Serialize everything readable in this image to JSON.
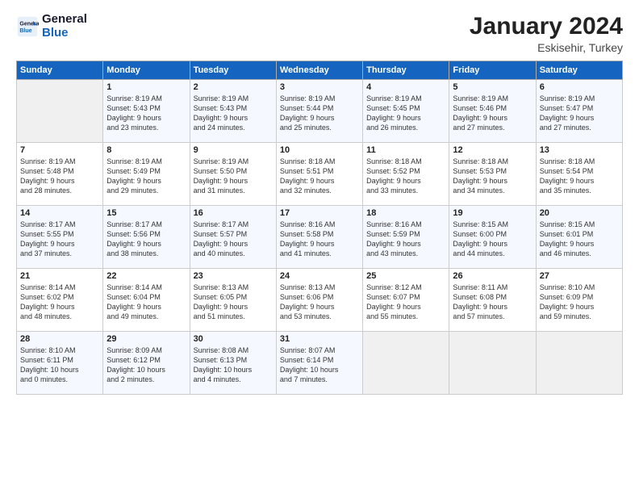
{
  "logo": {
    "line1": "General",
    "line2": "Blue"
  },
  "title": "January 2024",
  "subtitle": "Eskisehir, Turkey",
  "weekdays": [
    "Sunday",
    "Monday",
    "Tuesday",
    "Wednesday",
    "Thursday",
    "Friday",
    "Saturday"
  ],
  "weeks": [
    [
      {
        "day": "",
        "info": ""
      },
      {
        "day": "1",
        "info": "Sunrise: 8:19 AM\nSunset: 5:43 PM\nDaylight: 9 hours\nand 23 minutes."
      },
      {
        "day": "2",
        "info": "Sunrise: 8:19 AM\nSunset: 5:43 PM\nDaylight: 9 hours\nand 24 minutes."
      },
      {
        "day": "3",
        "info": "Sunrise: 8:19 AM\nSunset: 5:44 PM\nDaylight: 9 hours\nand 25 minutes."
      },
      {
        "day": "4",
        "info": "Sunrise: 8:19 AM\nSunset: 5:45 PM\nDaylight: 9 hours\nand 26 minutes."
      },
      {
        "day": "5",
        "info": "Sunrise: 8:19 AM\nSunset: 5:46 PM\nDaylight: 9 hours\nand 27 minutes."
      },
      {
        "day": "6",
        "info": "Sunrise: 8:19 AM\nSunset: 5:47 PM\nDaylight: 9 hours\nand 27 minutes."
      }
    ],
    [
      {
        "day": "7",
        "info": "Sunrise: 8:19 AM\nSunset: 5:48 PM\nDaylight: 9 hours\nand 28 minutes."
      },
      {
        "day": "8",
        "info": "Sunrise: 8:19 AM\nSunset: 5:49 PM\nDaylight: 9 hours\nand 29 minutes."
      },
      {
        "day": "9",
        "info": "Sunrise: 8:19 AM\nSunset: 5:50 PM\nDaylight: 9 hours\nand 31 minutes."
      },
      {
        "day": "10",
        "info": "Sunrise: 8:18 AM\nSunset: 5:51 PM\nDaylight: 9 hours\nand 32 minutes."
      },
      {
        "day": "11",
        "info": "Sunrise: 8:18 AM\nSunset: 5:52 PM\nDaylight: 9 hours\nand 33 minutes."
      },
      {
        "day": "12",
        "info": "Sunrise: 8:18 AM\nSunset: 5:53 PM\nDaylight: 9 hours\nand 34 minutes."
      },
      {
        "day": "13",
        "info": "Sunrise: 8:18 AM\nSunset: 5:54 PM\nDaylight: 9 hours\nand 35 minutes."
      }
    ],
    [
      {
        "day": "14",
        "info": "Sunrise: 8:17 AM\nSunset: 5:55 PM\nDaylight: 9 hours\nand 37 minutes."
      },
      {
        "day": "15",
        "info": "Sunrise: 8:17 AM\nSunset: 5:56 PM\nDaylight: 9 hours\nand 38 minutes."
      },
      {
        "day": "16",
        "info": "Sunrise: 8:17 AM\nSunset: 5:57 PM\nDaylight: 9 hours\nand 40 minutes."
      },
      {
        "day": "17",
        "info": "Sunrise: 8:16 AM\nSunset: 5:58 PM\nDaylight: 9 hours\nand 41 minutes."
      },
      {
        "day": "18",
        "info": "Sunrise: 8:16 AM\nSunset: 5:59 PM\nDaylight: 9 hours\nand 43 minutes."
      },
      {
        "day": "19",
        "info": "Sunrise: 8:15 AM\nSunset: 6:00 PM\nDaylight: 9 hours\nand 44 minutes."
      },
      {
        "day": "20",
        "info": "Sunrise: 8:15 AM\nSunset: 6:01 PM\nDaylight: 9 hours\nand 46 minutes."
      }
    ],
    [
      {
        "day": "21",
        "info": "Sunrise: 8:14 AM\nSunset: 6:02 PM\nDaylight: 9 hours\nand 48 minutes."
      },
      {
        "day": "22",
        "info": "Sunrise: 8:14 AM\nSunset: 6:04 PM\nDaylight: 9 hours\nand 49 minutes."
      },
      {
        "day": "23",
        "info": "Sunrise: 8:13 AM\nSunset: 6:05 PM\nDaylight: 9 hours\nand 51 minutes."
      },
      {
        "day": "24",
        "info": "Sunrise: 8:13 AM\nSunset: 6:06 PM\nDaylight: 9 hours\nand 53 minutes."
      },
      {
        "day": "25",
        "info": "Sunrise: 8:12 AM\nSunset: 6:07 PM\nDaylight: 9 hours\nand 55 minutes."
      },
      {
        "day": "26",
        "info": "Sunrise: 8:11 AM\nSunset: 6:08 PM\nDaylight: 9 hours\nand 57 minutes."
      },
      {
        "day": "27",
        "info": "Sunrise: 8:10 AM\nSunset: 6:09 PM\nDaylight: 9 hours\nand 59 minutes."
      }
    ],
    [
      {
        "day": "28",
        "info": "Sunrise: 8:10 AM\nSunset: 6:11 PM\nDaylight: 10 hours\nand 0 minutes."
      },
      {
        "day": "29",
        "info": "Sunrise: 8:09 AM\nSunset: 6:12 PM\nDaylight: 10 hours\nand 2 minutes."
      },
      {
        "day": "30",
        "info": "Sunrise: 8:08 AM\nSunset: 6:13 PM\nDaylight: 10 hours\nand 4 minutes."
      },
      {
        "day": "31",
        "info": "Sunrise: 8:07 AM\nSunset: 6:14 PM\nDaylight: 10 hours\nand 7 minutes."
      },
      {
        "day": "",
        "info": ""
      },
      {
        "day": "",
        "info": ""
      },
      {
        "day": "",
        "info": ""
      }
    ]
  ]
}
